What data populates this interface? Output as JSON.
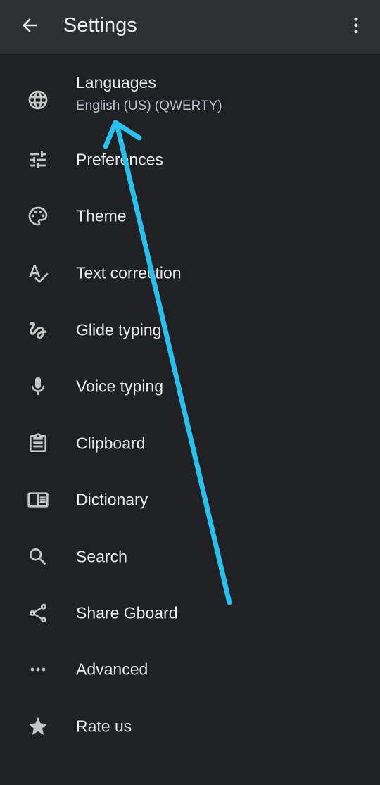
{
  "appbar": {
    "title": "Settings",
    "back_icon": "arrow-back-icon",
    "menu_icon": "more-vert-icon"
  },
  "items": [
    {
      "key": "languages",
      "label": "Languages",
      "subtitle": "English (US) (QWERTY)",
      "icon": "globe-icon"
    },
    {
      "key": "preferences",
      "label": "Preferences",
      "icon": "tune-icon"
    },
    {
      "key": "theme",
      "label": "Theme",
      "icon": "palette-icon"
    },
    {
      "key": "text-correction",
      "label": "Text correction",
      "icon": "spellcheck-icon"
    },
    {
      "key": "glide-typing",
      "label": "Glide typing",
      "icon": "gesture-icon"
    },
    {
      "key": "voice-typing",
      "label": "Voice typing",
      "icon": "mic-icon"
    },
    {
      "key": "clipboard",
      "label": "Clipboard",
      "icon": "clipboard-icon"
    },
    {
      "key": "dictionary",
      "label": "Dictionary",
      "icon": "book-icon"
    },
    {
      "key": "search",
      "label": "Search",
      "icon": "search-icon"
    },
    {
      "key": "share-gboard",
      "label": "Share Gboard",
      "icon": "share-icon"
    },
    {
      "key": "advanced",
      "label": "Advanced",
      "icon": "more-horiz-icon"
    },
    {
      "key": "rate-us",
      "label": "Rate us",
      "icon": "star-icon"
    }
  ],
  "colors": {
    "background": "#202124",
    "appbar": "#2e2f32",
    "text": "#e8eaed",
    "subtext": "#bdc1c6",
    "icon": "#c4c7c5",
    "annotation_arrow": "#27c0ef"
  }
}
